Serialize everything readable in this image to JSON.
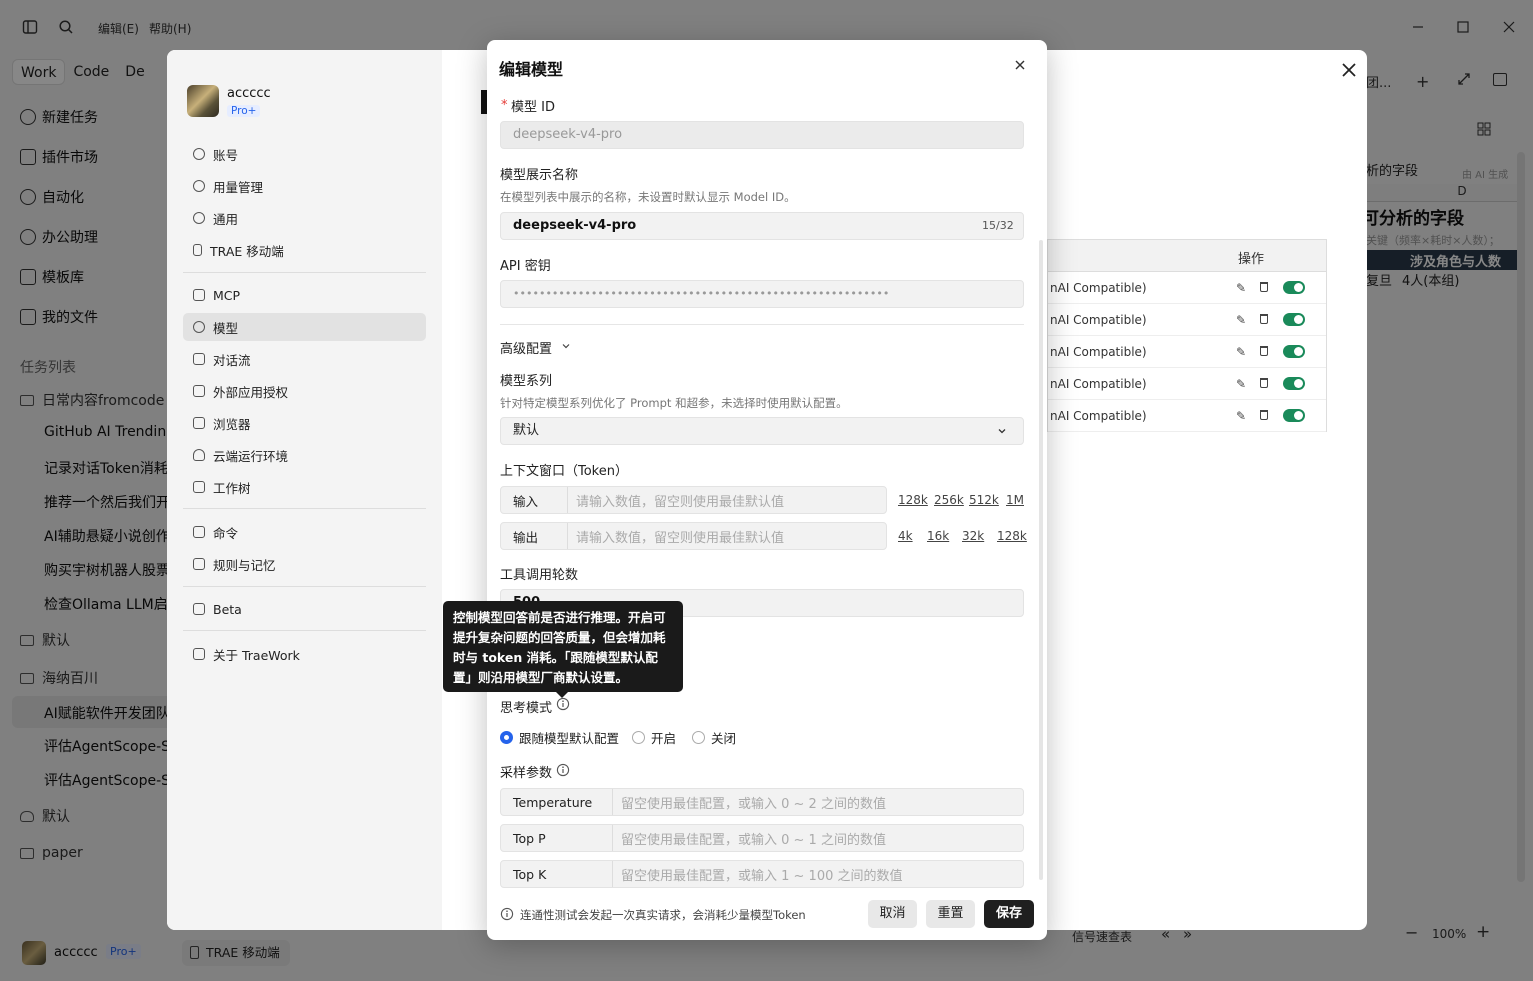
{
  "titlebar": {
    "menu_edit": "编辑(E)",
    "menu_help": "帮助(H)"
  },
  "app": {
    "mode_tabs": [
      "Work",
      "Code",
      "De"
    ],
    "nav": [
      "新建任务",
      "插件市场",
      "自动化",
      "办公助理",
      "模板库",
      "我的文件"
    ],
    "task_list_title": "任务列表",
    "folders": [
      {
        "name": "日常内容fromcode",
        "tasks": [
          "GitHub AI Trending",
          "记录对话Token消耗",
          "推荐一个然后我们开",
          "AI辅助悬疑小说创作",
          "购买宇树机器人股票",
          "检查Ollama LLM启动"
        ]
      },
      {
        "name": "默认",
        "tasks": []
      },
      {
        "name": "海纳百川",
        "tasks": [
          "AI赋能软件开发团队",
          "评估AgentScope-Sta",
          "评估AgentScope-Sta"
        ]
      },
      {
        "name": "默认",
        "tasks": []
      },
      {
        "name": "paper",
        "tasks": []
      }
    ],
    "user_name": "accccc",
    "user_badge": "Pro+",
    "mobile_btn": "TRAE 移动端",
    "right_header": "团...",
    "sheet": {
      "col": "D",
      "title_frag": "可分析的字段",
      "sub_frag": "关键（频率×耗时×人数）；",
      "th": "涉及角色与人数",
      "cell1": "复旦",
      "cell2": "4人(本组)",
      "name_frag": "析的字段",
      "ai_frag": "由 AI 生成",
      "zoom": "100%",
      "sheet_tab": "信号速查表"
    }
  },
  "settings": {
    "user": {
      "name": "accccc",
      "badge": "Pro+"
    },
    "menu1": [
      "账号",
      "用量管理",
      "通用",
      "TRAE 移动端"
    ],
    "menu2": [
      "MCP",
      "模型",
      "对话流",
      "外部应用授权",
      "浏览器",
      "云端运行环境",
      "工作树"
    ],
    "menu3": [
      "命令",
      "规则与记忆"
    ],
    "menu4": [
      "Beta"
    ],
    "menu5": [
      "关于 TraeWork"
    ],
    "active": "模型",
    "table_header": "操作",
    "rows": [
      "nAI Compatible)",
      "nAI Compatible)",
      "nAI Compatible)",
      "nAI Compatible)",
      "nAI Compatible)"
    ]
  },
  "modal": {
    "title": "编辑模型",
    "model_id_label": "模型 ID",
    "model_id_value": "deepseek-v4-pro",
    "display_name_label": "模型展示名称",
    "display_name_hint": "在模型列表中展示的名称，未设置时默认显示 Model ID。",
    "display_name_value": "deepseek-v4-pro",
    "display_name_count": "15/32",
    "api_key_label": "API 密钥",
    "api_key_value": "••••••••••••••••••••••••••••••••••••••••••••••••••••••••••",
    "advanced_label": "高级配置",
    "series_label": "模型系列",
    "series_hint": "针对特定模型系列优化了 Prompt 和超参，未选择时使用默认配置。",
    "series_value": "默认",
    "context_label": "上下文窗口（Token）",
    "input_label": "输入",
    "output_label": "输出",
    "ctx_placeholder": "请输入数值，留空则使用最佳默认值",
    "input_quick": [
      "128k",
      "256k",
      "512k",
      "1M"
    ],
    "output_quick": [
      "4k",
      "16k",
      "32k",
      "128k"
    ],
    "tool_rounds_label": "工具调用轮数",
    "tool_rounds_value": "500",
    "tooltip": "控制模型回答前是否进行推理。开启可提升复杂问题的回答质量，但会增加耗时与 token 消耗。「跟随模型默认配置」则沿用模型厂商默认设置。",
    "thinking_label": "思考模式",
    "thinking_options": [
      "跟随模型默认配置",
      "开启",
      "关闭"
    ],
    "thinking_selected": 0,
    "sampling_label": "采样参数",
    "temperature_label": "Temperature",
    "temperature_ph": "留空使用最佳配置，或输入 0 ~ 2 之间的数值",
    "topp_label": "Top P",
    "topp_ph": "留空使用最佳配置，或输入 0 ~ 1 之间的数值",
    "topk_label": "Top K",
    "topk_ph": "留空使用最佳配置，或输入 1 ~ 100 之间的数值",
    "footer_note": "连通性测试会发起一次真实请求，会消耗少量模型Token",
    "cancel": "取消",
    "reset": "重置",
    "save": "保存"
  },
  "colors": {
    "accent": "#2563eb",
    "toggle": "#1a8a5a",
    "primary_btn": "#1f1f1f"
  }
}
